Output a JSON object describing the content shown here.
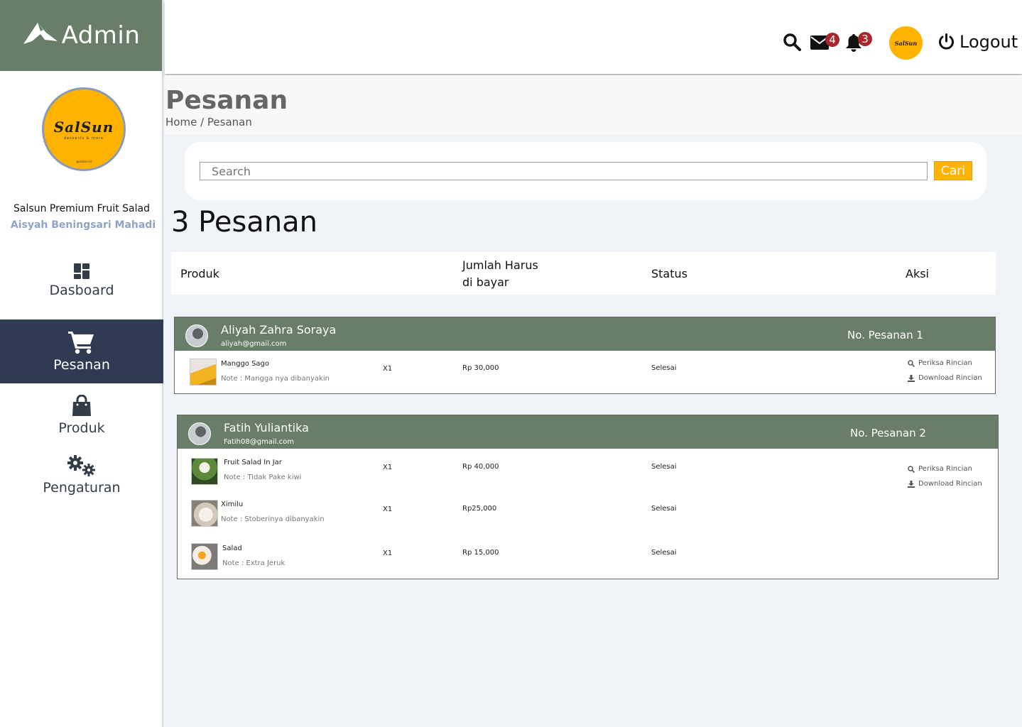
{
  "sidebar": {
    "brand": "Admin",
    "logo_text": "SalSun",
    "logo_sub": "desserts & more",
    "logo_foot": "@salsun.id",
    "shop_name": "Salsun Premium Fruit Salad",
    "owner_name": "Aisyah Beningsari Mahadi",
    "nav": [
      {
        "label": "Dasboard",
        "icon": "dashboard-icon"
      },
      {
        "label": "Pesanan",
        "icon": "cart-icon",
        "active": true
      },
      {
        "label": "Produk",
        "icon": "shopping-bag-icon"
      },
      {
        "label": "Pengaturan",
        "icon": "gears-icon"
      }
    ]
  },
  "header": {
    "mail_count": "4",
    "notif_count": "3",
    "avatar_text": "SalSun",
    "logout_label": "Logout"
  },
  "page": {
    "title": "Pesanan",
    "breadcrumb": "Home / Pesanan",
    "search_placeholder": "Search",
    "search_button": "Cari",
    "count_title": "3 Pesanan"
  },
  "table": {
    "headers": {
      "produk": "Produk",
      "jumlah_line1": "Jumlah Harus",
      "jumlah_line2": "di bayar",
      "status": "Status",
      "aksi": "Aksi"
    }
  },
  "orders": [
    {
      "customer": "Aliyah Zahra Soraya",
      "email": "aliyah@gmail.com",
      "order_no": "No. Pesanan 1",
      "items": [
        {
          "name": "Manggo Sago",
          "note": "Note : Mangga nya dibanyakin",
          "qty": "X1",
          "price": "Rp 30,000",
          "status": "Selesai"
        }
      ]
    },
    {
      "customer": "Fatih Yuliantika",
      "email": "Fatih08@gmail.com",
      "order_no": "No. Pesanan 2",
      "items": [
        {
          "name": "Fruit Salad In Jar",
          "note": "Note : Tidak Pake kiwi",
          "qty": "X1",
          "price": "Rp 40,000",
          "status": "Selesai"
        },
        {
          "name": "Ximilu",
          "note": "Note : Stoberinya dibanyakin",
          "qty": "X1",
          "price": "Rp25,000",
          "status": "Selesai"
        },
        {
          "name": "Salad",
          "note": "Note : Extra Jeruk",
          "qty": "X1",
          "price": "Rp 15,000",
          "status": "Selesai"
        }
      ]
    }
  ],
  "actions": {
    "view": "Periksa Rincian",
    "download": "Download  Rincian"
  },
  "colors": {
    "green": "#687e69",
    "navy": "#2e3b52",
    "yellow": "#ffb300",
    "badge": "#a8262c"
  }
}
